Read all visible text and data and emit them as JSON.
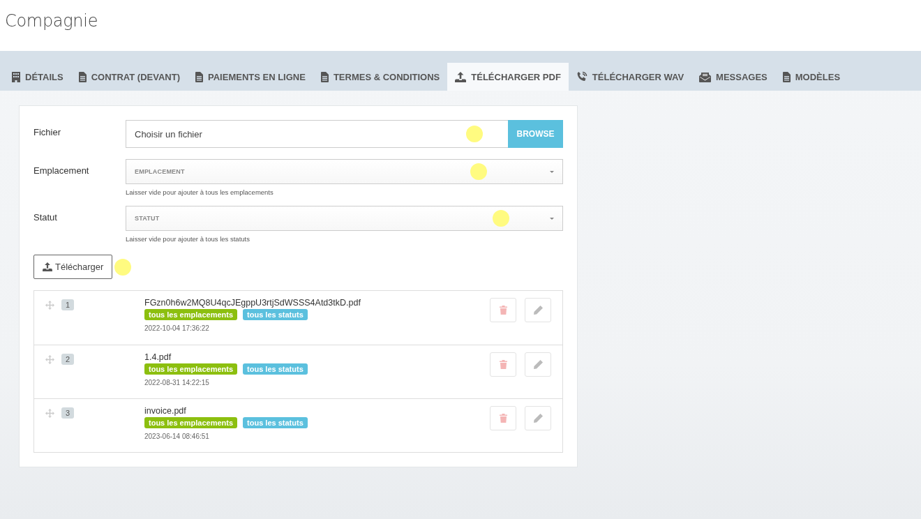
{
  "page_title": "Compagnie",
  "tabs": [
    {
      "label": "DÉTAILS",
      "kind": "building",
      "selected": false
    },
    {
      "label": "CONTRAT (DEVANT)",
      "kind": "document",
      "selected": false
    },
    {
      "label": "PAIEMENTS EN LIGNE",
      "kind": "document",
      "selected": false
    },
    {
      "label": "TERMES & CONDITIONS",
      "kind": "document",
      "selected": false
    },
    {
      "label": "TÉLÉCHARGER PDF",
      "kind": "upload",
      "selected": true
    },
    {
      "label": "TÉLÉCHARGER WAV",
      "kind": "phone",
      "selected": false
    },
    {
      "label": "MESSAGES",
      "kind": "envelope",
      "selected": false
    },
    {
      "label": "MODÈLES",
      "kind": "document",
      "selected": false
    }
  ],
  "form": {
    "fields": [
      {
        "kind": "file",
        "label": "Fichier",
        "placeholder": "Choisir un fichier",
        "button": "BROWSE",
        "click_marker": true
      },
      {
        "kind": "select",
        "label": "Emplacement",
        "placeholder": "EMPLACEMENT",
        "hint": "Laisser vide pour ajouter à tous les emplacements",
        "click_marker": true
      },
      {
        "kind": "select",
        "label": "Statut",
        "placeholder": "STATUT",
        "hint": "Laisser vide pour ajouter à tous les statuts",
        "click_marker": true
      }
    ],
    "submit": {
      "label": "Télécharger",
      "click_marker": true
    }
  },
  "files": [
    {
      "number": "1",
      "name": "FGzn0h6w2MQ8U4qcJEgppU3rtjSdWSSS4Atd3tkD.pdf",
      "tags": [
        {
          "label": "tous les emplacements",
          "color": "#8cbf0f"
        },
        {
          "label": "tous les statuts",
          "color": "#5bc0de"
        }
      ],
      "date": "2022-10-04 17:36:22"
    },
    {
      "number": "2",
      "name": "1.4.pdf",
      "tags": [
        {
          "label": "tous les emplacements",
          "color": "#8cbf0f"
        },
        {
          "label": "tous les statuts",
          "color": "#5bc0de"
        }
      ],
      "date": "2022-08-31 14:22:15"
    },
    {
      "number": "3",
      "name": "invoice.pdf",
      "tags": [
        {
          "label": "tous les emplacements",
          "color": "#8cbf0f"
        },
        {
          "label": "tous les statuts",
          "color": "#5bc0de"
        }
      ],
      "date": "2023-06-14 08:46:51"
    }
  ]
}
